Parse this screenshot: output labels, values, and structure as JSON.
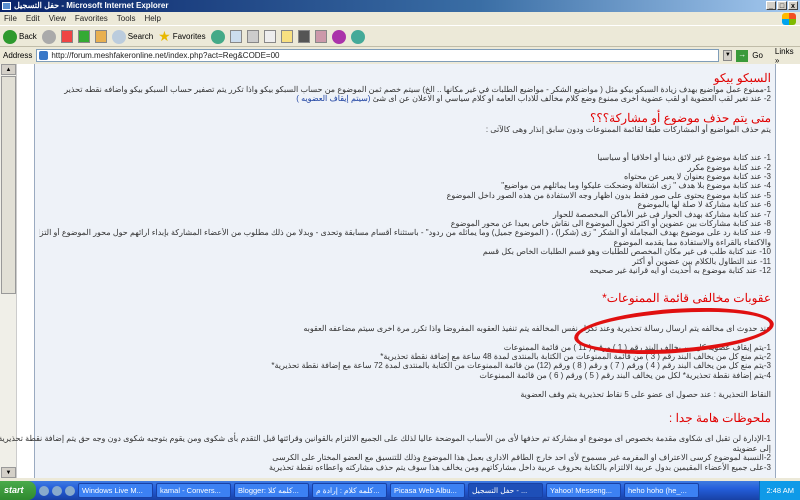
{
  "window": {
    "title": "حفل التسجيل - Microsoft Internet Explorer",
    "buttons": [
      "_",
      "□",
      "x"
    ]
  },
  "menu": [
    "File",
    "Edit",
    "View",
    "Favorites",
    "Tools",
    "Help"
  ],
  "toolbar": {
    "back": "Back",
    "search": "Search",
    "favorites": "Favorites"
  },
  "address": {
    "label": "Address",
    "url": "http://forum.meshfakeronline.net/index.php?act=Reg&CODE=00",
    "go": "Go",
    "links": "Links »"
  },
  "sections": [
    {
      "title": "السبكو بيكو",
      "lines": [
        "1-ممنوع عمل مواضيع بهدف زيادة السبكو بيكو مثل ( مواضيع الشكر - مواضيع الطلبات في غير مكانها .. الخ) سيتم خصم ثمن الموضوع من حساب السبكو بيكو واذا تكرر يتم تصفير حساب السبكو بيكو واضافه نقطه تحذير",
        "2- عند تغير لقب العضوية او لقب عضوية اخرى ممنوع وضع كلام مخالف للاداب العامه او كلام سياسي او الاعلان عن اى شئ"
      ],
      "link": "(سيتم إيقاف العضويه )"
    },
    {
      "title": "متى يتم حذف موضوع أو مشاركة؟؟؟",
      "intro": "يتم حذف المواضيع أو المشاركات طبقا لقائمة الممنوعات ودون سابق إنذار وهى كالآتى :",
      "lines": [
        "1- عند كتابة موضوع غير لائق دينيا أو اخلاقيا أو سياسيا",
        "2- عند كتابة موضوع مكرر",
        "3- عند كتابة موضوع بعنوان لا يعبر عن محتواه",
        "4- عند كتابة موضوع بلا هدف \" زى اشتغالة وضحكت عليكوا وما يماثلهم من مواضيع\"",
        "5- عند كتابة موضوع يحتوى على صور فقط بدون اظهار وجه الاستفادة من هذه الصور داخل الموضوع",
        "6- عند كتابة مشاركة لا صلة لها بالموضوع",
        "7- عند كتابة مشاركة بهدف الحوار فى غير الأماكن المخصصة للحوار",
        "8- عند كتابة مشاركات بين عضوين أو اكثر تحول الموضوع الى نقاش خاص بعيدا عن محور الموضوع",
        "9- عند كتابة رد على موضوع بهدف المجاملة أو الشكر \" زى (شكرا) ، ( الموضوع جميل) وما يماثله من ردود\" - باستثناء أقسام مسابقة وتحدى - وبدلا من ذلك مطلوب من الأعضاء المشاركة بإبداء آرائهم حول محور الموضوع أو التزام الصمت",
        "والاكتفاء بالقراءة والاستفادة مما يقدمه الموضوع",
        "10- عند كتابة طلب فى غير مكان المخصص للطلبات وهو قسم الطلبات الخاص بكل قسم",
        "11- عند التطاول بالكلام بين عضوين أو أكثر",
        "12- عند كتابة موضوع به أحديث او ايه قرانية غير صحيحه"
      ]
    },
    {
      "title": "عقوبات مخالفى قائمة الممنوعات*",
      "intro": "عند حدوث اى مخالفه يتم ارسال رسالة تحذيرية وعند تكرار نفس المخالفه يتم تنفيذ العقوبه المفروضا واذا تكرر مرة اخرى سيتم مضاعفه العقوبه",
      "lines": [
        "1-يتم إيقاف عضوية كل من يخالف البند رقم ( 1 ) ورقم ( 11 ) من قائمة الممنوعات",
        "2-يتم منع كل من يخالف البند رقم ( 3 ) من قائمة الممنوعات من الكتابة بالمنتدى لمدة 48 ساعة مع إضافة نقطة تحذيرية*",
        "3-يتم منع كل من يخالف البند رقم ( 4 ) ورقم ( 7 ) و رقم ( 8 ) ورقم (12) من قائمة الممنوعات من الكتابة بالمنتدى لمدة 72 ساعة مع إضافة نقطة تحذيرية*",
        "4-يتم إضافة نقطة تحذيرية* لكل من يخالف البند رقم ( 5 ) ورقم ( 6 ) من قائمة الممنوعات"
      ],
      "note": "النقاط التحذيرية : عند حصول اى عضو على 5 نقاط تحذيرية يتم وقف العضوية"
    },
    {
      "title": "ملحوظات هامة جدا :",
      "lines": [
        "1-الإدارة لن تقبل اى شكاوى مقدمة بخصوص اى موضوع او مشاركة تم حذفها لأى من الأسباب الموضحة عاليا لذلك على الجميع الالتزام بالقوانين وقرائتها قبل التقدم بأى شكوى ومن يقوم بتوجيه شكوى دون وجه حق يتم إضافة نقطة تحذيرية",
        "إلى عضويته",
        "2-النسبة لموضوع كرسى الاعتراف او المفرمه غير مسموح لأى احد خارج الطاقم الادارى بعمل هذا الموضوع وذلك للتنسيق مع العضو المختار على الكرسى",
        "3-على جميع الأعضاء المقيمين بدول عربية الالتزام بالكتابة بحروف عربية داخل مشاركاتهم ومن يخالف هذا سوف يتم حذف مشاركته واعطاءه نقطة تحذيرية"
      ]
    }
  ],
  "annotation": {
    "color": "#e01010"
  },
  "taskbar": {
    "start": "start",
    "tasks": [
      "Windows Live M...",
      "kamal - Convers...",
      "Blogger: كلمه كلا...",
      "كلمه كلام : إرادة م...",
      "Picasa Web Albu...",
      "حفل التسجيل - ...",
      "Yahoo! Messeng...",
      "heho hoho (he_..."
    ],
    "clock": "2:48 AM"
  }
}
